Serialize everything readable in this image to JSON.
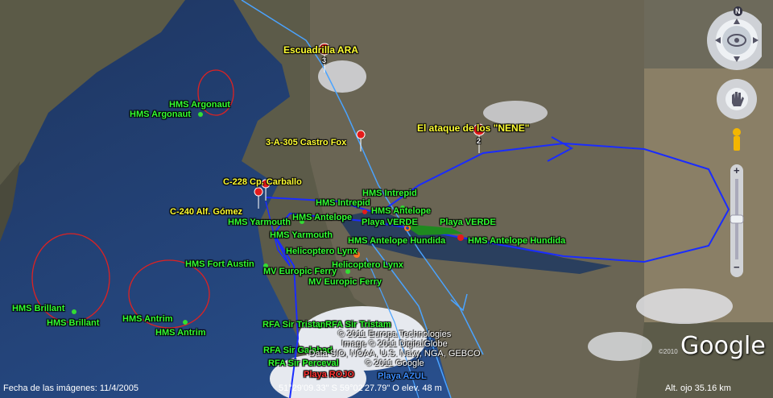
{
  "labels": {
    "escuadrilla": "Escuadrilla ARA",
    "ataque": "El ataque de los \"NENE\"",
    "castro_fox": "3-A-305 Castro Fox",
    "carballo": "C-228 Cp. Carballo",
    "gomez": "C-240 Alf. Gómez",
    "argonaut_1": "HMS Argonaut",
    "argonaut_2": "HMS Argonaut",
    "intrepid_1": "HMS Intrepid",
    "intrepid_2": "HMS Intrepid",
    "antelope_1": "HMS Antelope",
    "antelope_2": "HMS Antelope",
    "yarmouth_1": "HMS Yarmouth",
    "yarmouth_2": "HMS Yarmouth",
    "playa_verde_1": "Playa VERDE",
    "playa_verde_2": "Playa VERDE",
    "antelope_hundida_1": "HMS Antelope Hundida",
    "antelope_hundida_2": "HMS Antelope Hundida",
    "lynx_1": "Helicoptero Lynx",
    "lynx_2": "Helicoptero Lynx",
    "fort_austin": "HMS Fort Austin",
    "europic_1": "MV Europic Ferry",
    "europic_2": "MV Europic Ferry",
    "brilliant_1": "HMS Brillant",
    "brilliant_2": "HMS Brillant",
    "antrim_1": "HMS Antrim",
    "antrim_2": "HMS Antrim",
    "tristam_1": "RFA Sir Tristam",
    "tristam_2": "RFA Sir Tristam",
    "galahad": "RFA Sir Galahad",
    "percival": "RFA Sir Perceval",
    "playa_rojo": "Playa ROJO",
    "playa_azul": "Playa AZUL",
    "marker_3": "3",
    "marker_2": "2"
  },
  "copyright": {
    "line1": "© 2011 Europa Technologies",
    "line2": "Image © 2011 DigitalGlobe",
    "line3": "Data SIO, NOAA, U.S. Navy, NGA, GEBCO",
    "line4": "© 2011 Google"
  },
  "logo": {
    "text": "Google",
    "year": "©2010"
  },
  "status": {
    "imagery_date": "Fecha de las imágenes: 11/4/2005",
    "coords": "51°29'09.33\" S  59°02'27.79\" O  elev.   48 m",
    "eye_alt": "Alt. ojo    35.16 km"
  },
  "compass": {
    "north": "N"
  },
  "zoom": {
    "plus": "+",
    "minus": "−"
  },
  "colors": {
    "route": "#1a2cff",
    "sea": "#2f4d86",
    "land": "#5a5a44"
  }
}
